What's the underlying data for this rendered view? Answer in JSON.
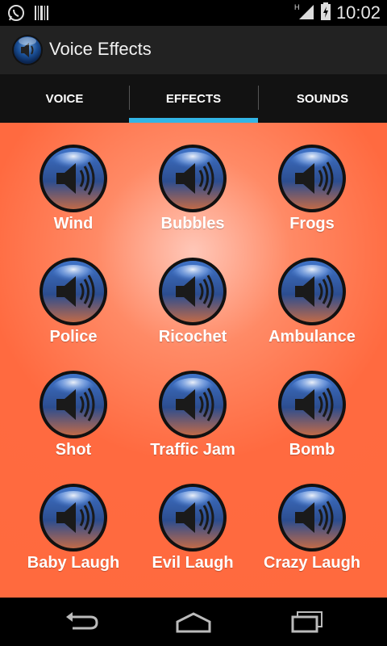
{
  "status_bar": {
    "time": "10:02",
    "icons": [
      "whatsapp-icon",
      "barcode-icon",
      "signal-icon",
      "battery-icon"
    ]
  },
  "action_bar": {
    "title": "Voice Effects",
    "icon": "speaker-icon"
  },
  "tabs": [
    {
      "label": "VOICE",
      "active": false
    },
    {
      "label": "EFFECTS",
      "active": true
    },
    {
      "label": "SOUNDS",
      "active": false
    }
  ],
  "effects": [
    {
      "label": "Wind",
      "icon": "speaker-icon"
    },
    {
      "label": "Bubbles",
      "icon": "speaker-icon"
    },
    {
      "label": "Frogs",
      "icon": "speaker-icon"
    },
    {
      "label": "Police",
      "icon": "speaker-icon"
    },
    {
      "label": "Ricochet",
      "icon": "speaker-icon"
    },
    {
      "label": "Ambulance",
      "icon": "speaker-icon"
    },
    {
      "label": "Shot",
      "icon": "speaker-icon"
    },
    {
      "label": "Traffic Jam",
      "icon": "speaker-icon"
    },
    {
      "label": "Bomb",
      "icon": "speaker-icon"
    },
    {
      "label": "Baby Laugh",
      "icon": "speaker-icon"
    },
    {
      "label": "Evil Laugh",
      "icon": "speaker-icon"
    },
    {
      "label": "Crazy Laugh",
      "icon": "speaker-icon"
    }
  ],
  "nav_bar": {
    "icons": [
      "back-icon",
      "home-icon",
      "recent-apps-icon"
    ]
  },
  "colors": {
    "accent": "#33b5e5",
    "content_bg": "#ff6a3d",
    "action_bar_bg": "#222222"
  }
}
